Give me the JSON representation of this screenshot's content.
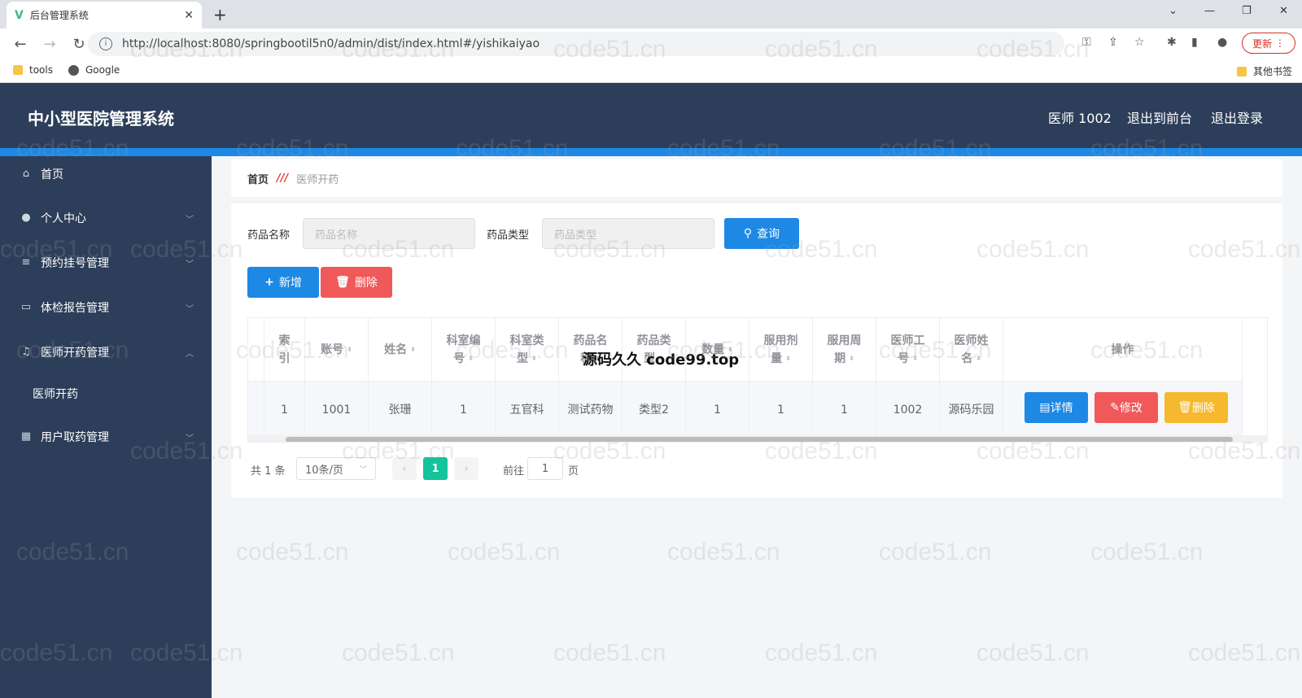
{
  "browser": {
    "tab_title": "后台管理系统",
    "url": "http://localhost:8080/springbootil5n0/admin/dist/index.html#/yishikaiyao",
    "update_label": "更新",
    "bookmarks": [
      "tools",
      "Google"
    ],
    "other_bookmarks": "其他书签"
  },
  "header": {
    "title": "中小型医院管理系统",
    "user": "医师 1002",
    "to_front": "退出到前台",
    "logout": "退出登录"
  },
  "sidebar": {
    "items": [
      {
        "label": "首页",
        "icon": "home-icon"
      },
      {
        "label": "个人中心",
        "icon": "user-icon"
      },
      {
        "label": "预约挂号管理",
        "icon": "menu-icon"
      },
      {
        "label": "体检报告管理",
        "icon": "chat-icon"
      },
      {
        "label": "医师开药管理",
        "icon": "bell-icon"
      },
      {
        "label": "医师开药",
        "icon": ""
      },
      {
        "label": "用户取药管理",
        "icon": "chart-icon"
      }
    ]
  },
  "breadcrumb": {
    "home": "首页",
    "current": "医师开药"
  },
  "search": {
    "drug_name_label": "药品名称",
    "drug_name_placeholder": "药品名称",
    "drug_type_label": "药品类型",
    "drug_type_placeholder": "药品类型",
    "query_button": "查询"
  },
  "actions": {
    "add": "新增",
    "delete": "删除"
  },
  "table": {
    "headers": [
      "索引",
      "账号",
      "姓名",
      "科室编号",
      "科室类型",
      "药品名称",
      "药品类型",
      "数量",
      "服用剂量",
      "服用周期",
      "医师工号",
      "医师姓名",
      "操作"
    ],
    "header_lines": [
      [
        "索",
        "引"
      ],
      [
        "账号"
      ],
      [
        "姓名"
      ],
      [
        "科室编",
        "号"
      ],
      [
        "科室类",
        "型"
      ],
      [
        "药品名",
        "称"
      ],
      [
        "药品类",
        "型"
      ],
      [
        "数量"
      ],
      [
        "服用剂",
        "量"
      ],
      [
        "服用周",
        "期"
      ],
      [
        "医师工",
        "号"
      ],
      [
        "医师姓",
        "名"
      ],
      [
        "操作"
      ]
    ],
    "row": [
      "1",
      "1001",
      "张珊",
      "1",
      "五官科",
      "测试药物",
      "类型2",
      "1",
      "1",
      "1",
      "1002",
      "源码乐园"
    ],
    "row_buttons": {
      "detail": "详情",
      "edit": "修改",
      "delete": "删除"
    }
  },
  "pagination": {
    "total": "共 1 条",
    "page_size": "10条/页",
    "current_page": "1",
    "goto_label": "前往",
    "goto_value": "1",
    "page_suffix": "页"
  },
  "overlay_text": "源码久久 code99.top",
  "watermark": "code51.cn",
  "colors": {
    "primary": "#1e88e5",
    "danger": "#f0595a",
    "warning": "#f5b82e",
    "sidebar": "#2c3e59",
    "pager_active": "#13c39c"
  }
}
